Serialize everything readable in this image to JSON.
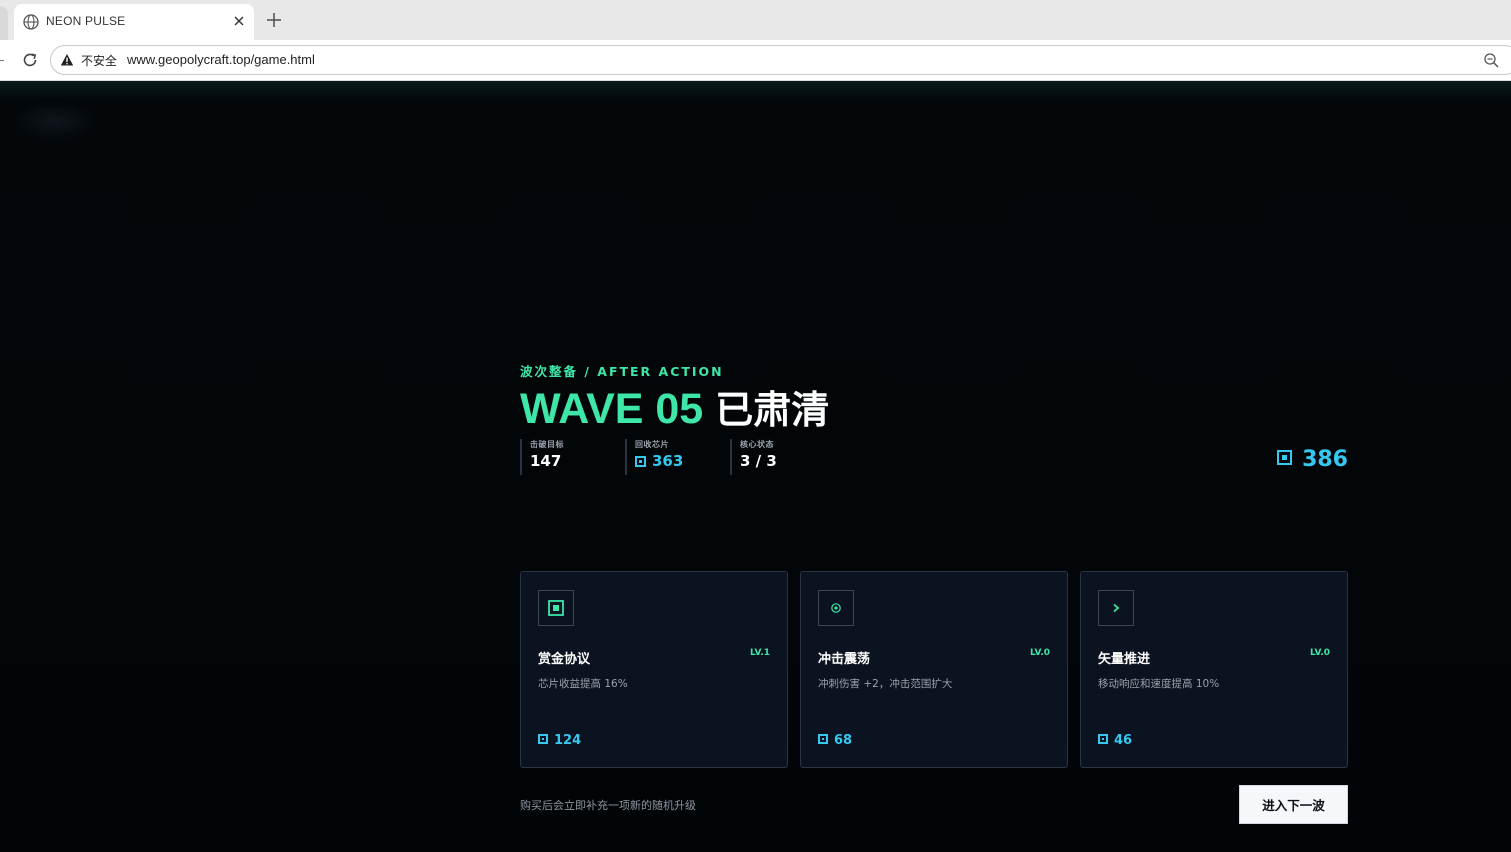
{
  "browser": {
    "tab_title": "NEON PULSE",
    "security_label": "不安全",
    "url": "www.geopolycraft.top/game.html"
  },
  "game": {
    "eyebrow": "波次整备 / AFTER ACTION",
    "wave_label": "WAVE 05",
    "status_label": "已肃清",
    "stats": [
      {
        "label": "击破目标",
        "value": "147"
      },
      {
        "label": "回收芯片",
        "value": "363"
      },
      {
        "label": "核心状态",
        "value": "3 / 3"
      }
    ],
    "balance": "386",
    "cards": [
      {
        "icon": "chip-icon",
        "name": "赏金协议",
        "level": "LV.1",
        "description": "芯片收益提高 16%",
        "cost": "124"
      },
      {
        "icon": "shockwave-icon",
        "name": "冲击震荡",
        "level": "LV.0",
        "description": "冲刺伤害 +2，冲击范围扩大",
        "cost": "68"
      },
      {
        "icon": "chevron-right-icon",
        "name": "矢量推进",
        "level": "LV.0",
        "description": "移动响应和速度提高 10%",
        "cost": "46"
      }
    ],
    "footnote": "购买后会立即补充一项新的随机升级",
    "next_button": "进入下一波"
  },
  "colors": {
    "accent_green": "#3ee6a8",
    "accent_cyan": "#35c8f0",
    "background": "#03060a",
    "card_bg": "#0b1320"
  }
}
